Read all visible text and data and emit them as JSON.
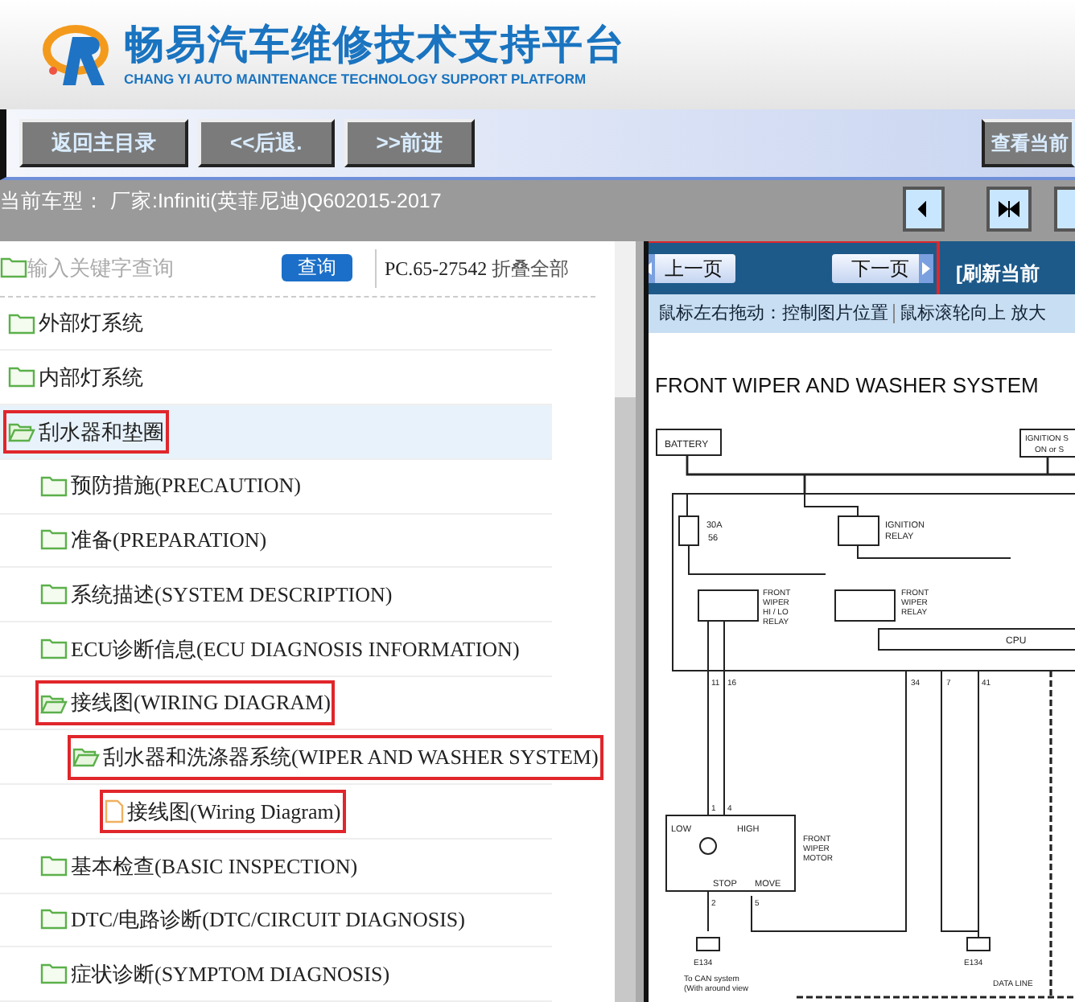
{
  "header": {
    "title": "畅易汽车维修技术支持平台",
    "subtitle": "CHANG YI AUTO MAINTENANCE TECHNOLOGY SUPPORT PLATFORM"
  },
  "nav_buttons": [
    "返回主目录",
    "<<后退.",
    ">>前进"
  ],
  "view_button": "查看当前",
  "vehicle": "当前车型： 厂家:Infiniti(英菲尼迪)Q602015-2017",
  "sidebar": {
    "search": {
      "placeholder": "输入关键字查询",
      "button": "查询"
    },
    "code": "PC.65-27542",
    "collapse_all": "折叠全部",
    "tree": [
      {
        "kind": "folder",
        "label": "外部灯系统",
        "expanded": false,
        "selected": false,
        "highlighted": false
      },
      {
        "kind": "folder",
        "label": "内部灯系统",
        "expanded": false,
        "selected": false,
        "highlighted": false
      },
      {
        "kind": "folder",
        "label": "刮水器和垫圈",
        "expanded": true,
        "selected": true,
        "highlighted": true,
        "children": [
          {
            "kind": "folder",
            "label": "预防措施(PRECAUTION)",
            "expanded": false,
            "selected": false,
            "highlighted": false
          },
          {
            "kind": "folder",
            "label": "准备(PREPARATION)",
            "expanded": false,
            "selected": false,
            "highlighted": false
          },
          {
            "kind": "folder",
            "label": "系统描述(SYSTEM DESCRIPTION)",
            "expanded": false,
            "selected": false,
            "highlighted": false
          },
          {
            "kind": "folder",
            "label": "ECU诊断信息(ECU DIAGNOSIS INFORMATION)",
            "expanded": false,
            "selected": false,
            "highlighted": false
          },
          {
            "kind": "folder",
            "label": "接线图(WIRING DIAGRAM)",
            "expanded": true,
            "selected": false,
            "highlighted": true,
            "children": [
              {
                "kind": "folder",
                "label": "刮水器和洗涤器系统(WIPER AND WASHER SYSTEM)",
                "expanded": true,
                "selected": false,
                "highlighted": true,
                "children": [
                  {
                    "kind": "file",
                    "label": "接线图(Wiring Diagram)",
                    "selected": false,
                    "highlighted": true
                  }
                ]
              }
            ]
          },
          {
            "kind": "folder",
            "label": "基本检查(BASIC INSPECTION)",
            "expanded": false,
            "selected": false,
            "highlighted": false
          },
          {
            "kind": "folder",
            "label": "DTC/电路诊断(DTC/CIRCUIT DIAGNOSIS)",
            "expanded": false,
            "selected": false,
            "highlighted": false
          },
          {
            "kind": "folder",
            "label": "症状诊断(SYMPTOM DIAGNOSIS)",
            "expanded": false,
            "selected": false,
            "highlighted": false
          }
        ]
      }
    ]
  },
  "viewer": {
    "prev_page": "上一页",
    "next_page": "下一页",
    "page_nav_highlighted": true,
    "refresh": "[刷新当前",
    "hint_drag": "鼠标左右拖动：控制图片位置",
    "hint_wheel": "鼠标滚轮向上 放大",
    "diagram": {
      "title": "FRONT WIPER AND WASHER SYSTEM",
      "labels": [
        "BATTERY",
        "IGNITION S",
        "ON or S",
        "30A",
        "56",
        "IGNITION",
        "RELAY",
        "FRONT",
        "WIPER",
        "HI / LO",
        "RELAY",
        "FRONT",
        "WIPER",
        "RELAY",
        "CPU",
        "11",
        "16",
        "34",
        "7",
        "41",
        "1",
        "4",
        "LOW",
        "HIGH",
        "FRONT",
        "WIPER",
        "MOTOR",
        "STOP",
        "MOVE",
        "2",
        "5",
        "E134",
        "E134",
        "To CAN system",
        "(With around view",
        "DATA LINE"
      ]
    }
  }
}
